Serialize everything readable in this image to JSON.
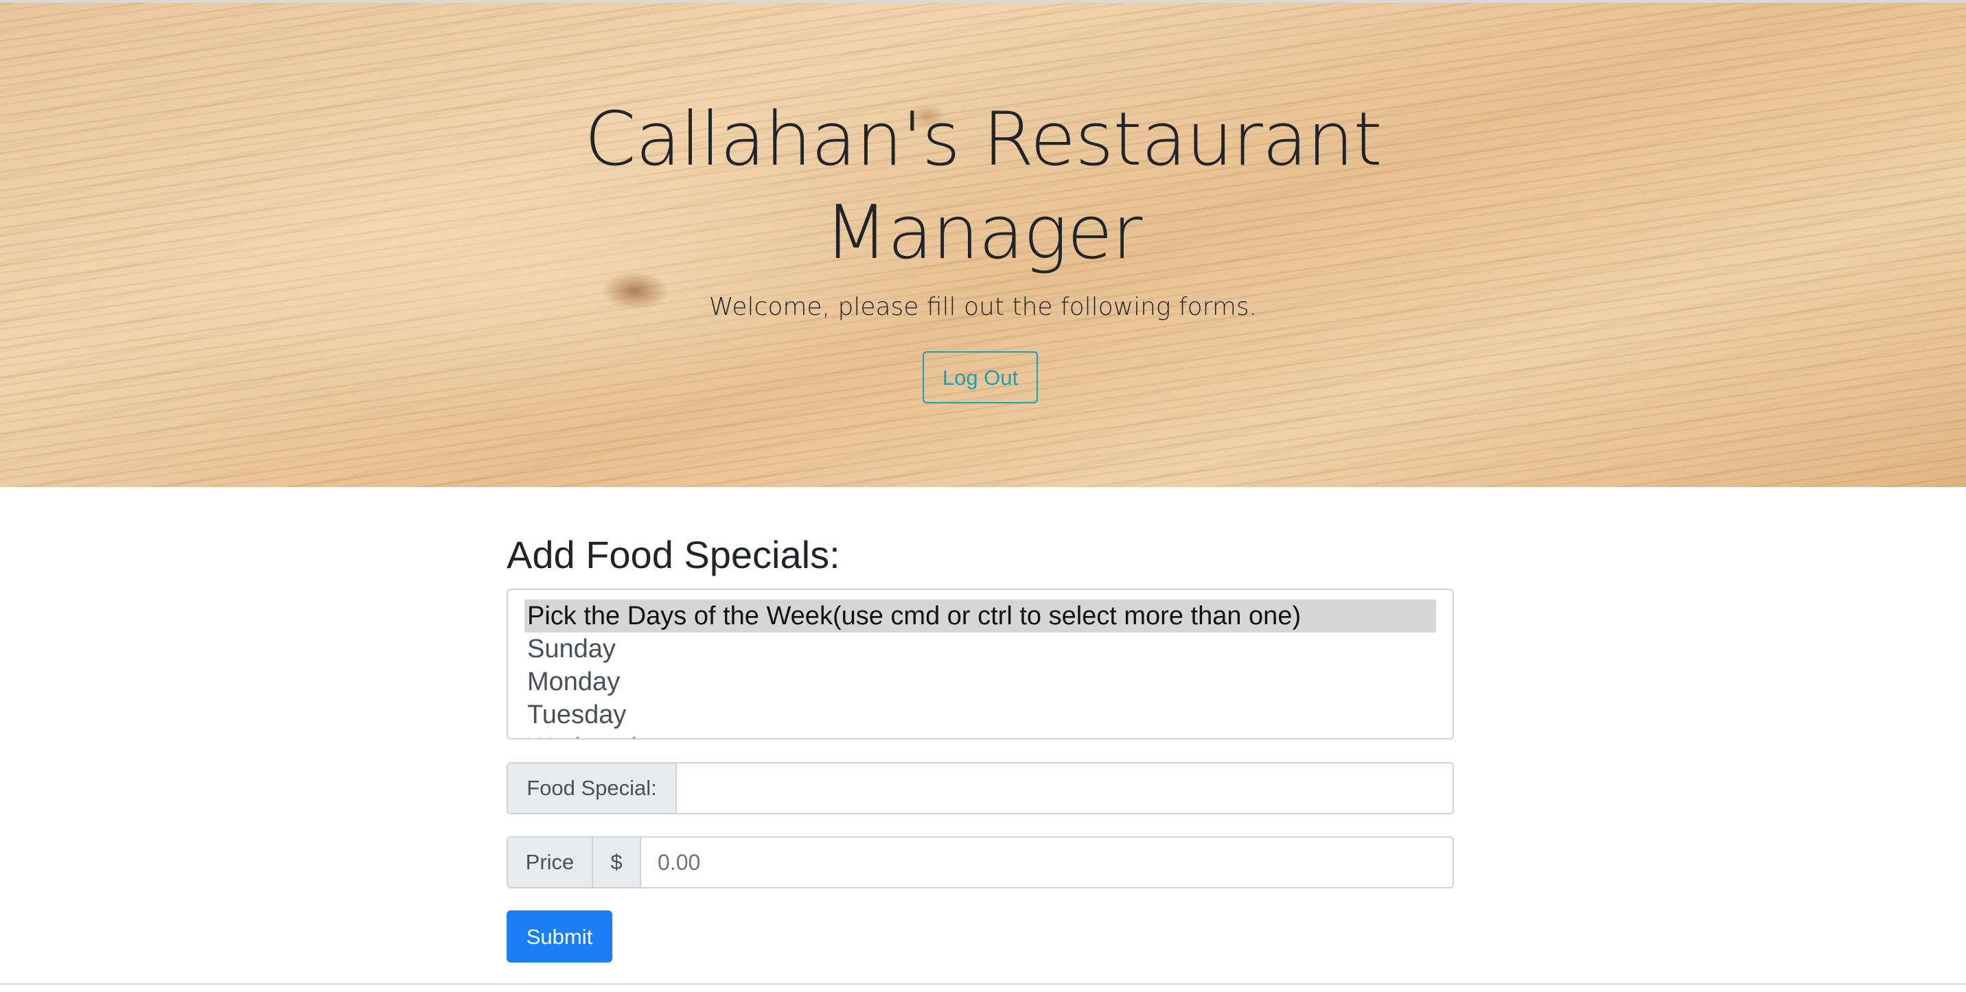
{
  "hero": {
    "title_line1": "Callahan's Restaurant",
    "title_line2": "Manager",
    "subtitle": "Welcome, please fill out the following forms.",
    "logout_label": "Log Out",
    "accent_color": "#17a2b8"
  },
  "form": {
    "heading": "Add Food Specials:",
    "days_select": {
      "options": [
        "Pick the Days of the Week(use cmd or ctrl to select more than one)",
        "Sunday",
        "Monday",
        "Tuesday",
        "Wednesday"
      ],
      "selected_index": 0
    },
    "food_special": {
      "label": "Food Special:",
      "value": "",
      "placeholder": ""
    },
    "price": {
      "label": "Price",
      "currency": "$",
      "value": "",
      "placeholder": "0.00"
    },
    "submit_label": "Submit",
    "submit_color": "#1a7ff6"
  }
}
